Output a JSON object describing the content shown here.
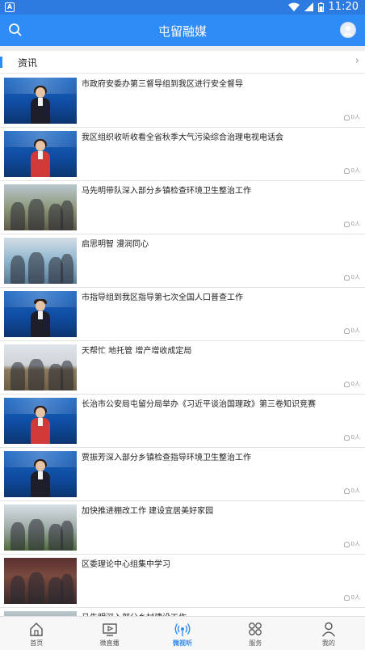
{
  "status_bar": {
    "time": "11:20",
    "left_icon": "A"
  },
  "header": {
    "title": "屯留融媒"
  },
  "section": {
    "label": "资讯"
  },
  "news": [
    {
      "title": "市政府安委办第三督导组到我区进行安全督导",
      "views": "0人",
      "thumb": "anchor-female"
    },
    {
      "title": "我区组织收听收看全省秋季大气污染综合治理电视电话会",
      "views": "0人",
      "thumb": "anchor-female-red"
    },
    {
      "title": "马先明带队深入部分乡镇检查环境卫生整治工作",
      "views": "0人",
      "thumb": "scene-outdoor"
    },
    {
      "title": "启思明智 漫润同心",
      "views": "0人",
      "thumb": "scene-kids"
    },
    {
      "title": "市指导组到我区指导第七次全国人口普查工作",
      "views": "0人",
      "thumb": "anchor-male"
    },
    {
      "title": "天帮忙 地托管 增产增收成定局",
      "views": "0人",
      "thumb": "scene-field"
    },
    {
      "title": "长治市公安局屯留分局举办《习近平谈治国理政》第三卷知识竞赛",
      "views": "0人",
      "thumb": "anchor-female-red"
    },
    {
      "title": "贾振芳深入部分乡镇检查指导环境卫生整治工作",
      "views": "0人",
      "thumb": "anchor-female"
    },
    {
      "title": "加快推进棚改工作 建设宜居美好家园",
      "views": "0人",
      "thumb": "scene-building"
    },
    {
      "title": "区委理论中心组集中学习",
      "views": "0人",
      "thumb": "scene-meeting"
    },
    {
      "title": "马先明深入部分乡村建设工作",
      "views": "",
      "thumb": "scene-outdoor"
    }
  ],
  "tabs": [
    {
      "label": "首页",
      "icon": "home-icon",
      "active": false
    },
    {
      "label": "微直播",
      "icon": "tv-play-icon",
      "active": false
    },
    {
      "label": "微视听",
      "icon": "broadcast-icon",
      "active": true
    },
    {
      "label": "服务",
      "icon": "grid-icon",
      "active": false
    },
    {
      "label": "我的",
      "icon": "user-icon",
      "active": false
    }
  ],
  "colors": {
    "primary": "#2f8bf5",
    "status_bar": "#2c7be0"
  }
}
